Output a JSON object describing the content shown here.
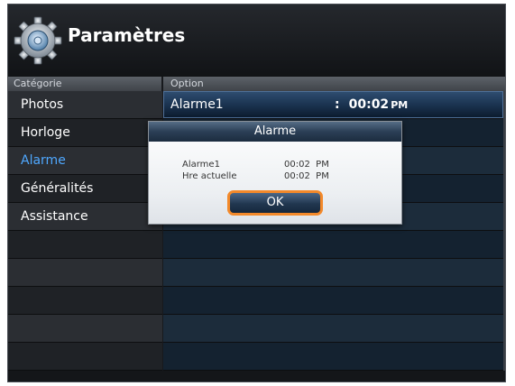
{
  "header": {
    "title": "Paramètres",
    "icon": "gear-icon"
  },
  "columns": {
    "category": "Catégorie",
    "option": "Option"
  },
  "sidebar": {
    "items": [
      {
        "label": "Photos"
      },
      {
        "label": "Horloge"
      },
      {
        "label": "Alarme",
        "selected": true
      },
      {
        "label": "Généralités"
      },
      {
        "label": "Assistance"
      }
    ],
    "active_color": "#4fa8ff"
  },
  "options": {
    "alarm_row": {
      "label": "Alarme1",
      "separator": ":",
      "time": "00:02",
      "ampm": "PM"
    }
  },
  "dialog": {
    "title": "Alarme",
    "rows": [
      {
        "label": "Alarme1",
        "value": "00:02  PM"
      },
      {
        "label": "Hre actuelle",
        "value": "00:02  PM"
      }
    ],
    "ok_label": "OK",
    "focus_color": "#f3892a"
  }
}
